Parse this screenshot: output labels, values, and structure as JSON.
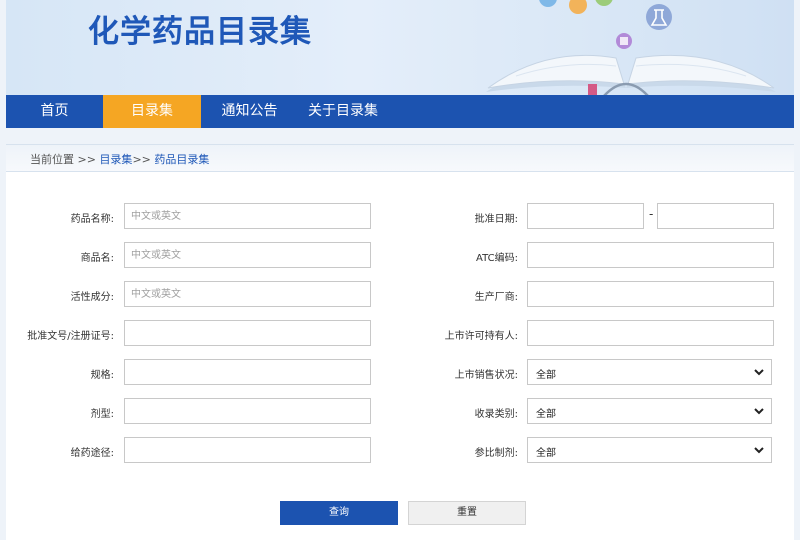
{
  "header": {
    "title": "化学药品目录集"
  },
  "nav": {
    "items": [
      {
        "label": "首页",
        "active": false
      },
      {
        "label": "目录集",
        "active": true
      },
      {
        "label": "通知公告",
        "active": false
      },
      {
        "label": "关于目录集",
        "active": false
      }
    ]
  },
  "breadcrumb": {
    "prefix": "当前位置 >> ",
    "level1": "目录集",
    "sep": ">> ",
    "level2": "药品目录集"
  },
  "form": {
    "left": [
      {
        "label": "药品名称:",
        "placeholder": "中文或英文",
        "value": ""
      },
      {
        "label": "商品名:",
        "placeholder": "中文或英文",
        "value": ""
      },
      {
        "label": "活性成分:",
        "placeholder": "中文或英文",
        "value": ""
      },
      {
        "label": "批准文号/注册证号:",
        "placeholder": "",
        "value": ""
      },
      {
        "label": "规格:",
        "placeholder": "",
        "value": ""
      },
      {
        "label": "剂型:",
        "placeholder": "",
        "value": ""
      },
      {
        "label": "给药途径:",
        "placeholder": "",
        "value": ""
      }
    ],
    "right": {
      "approval_date": {
        "label": "批准日期:",
        "start": "",
        "end": "",
        "separator": "-"
      },
      "atc": {
        "label": "ATC编码:",
        "value": ""
      },
      "manufacturer": {
        "label": "生产厂商:",
        "value": ""
      },
      "holder": {
        "label": "上市许可持有人:",
        "value": ""
      },
      "sales_status": {
        "label": "上市销售状况:",
        "selected": "全部"
      },
      "category": {
        "label": "收录类别:",
        "selected": "全部"
      },
      "reference": {
        "label": "参比制剂:",
        "selected": "全部"
      }
    }
  },
  "buttons": {
    "search": "查询",
    "reset": "重置"
  },
  "colors": {
    "primary": "#1c53b0",
    "accent": "#f5a623",
    "title": "#1f58b8"
  }
}
